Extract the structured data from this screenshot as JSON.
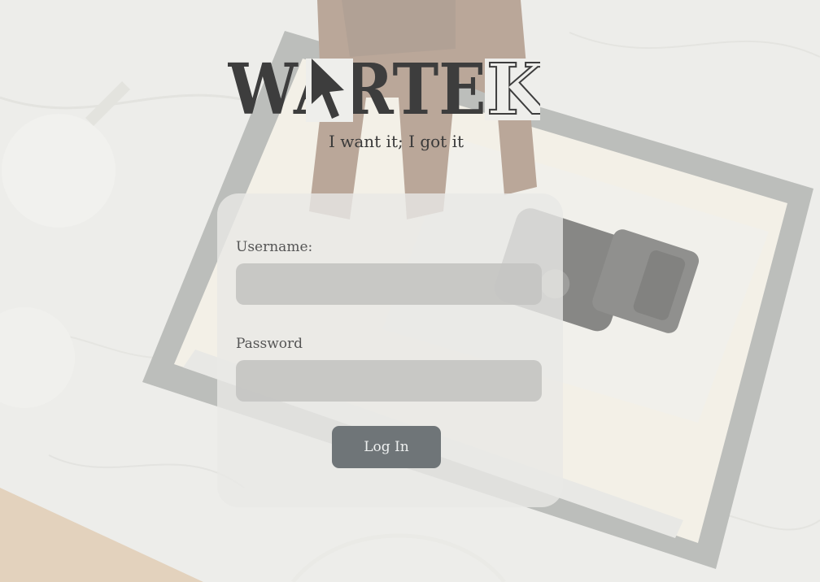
{
  "brand": {
    "logo_text": "WARTEK",
    "tagline": "I want it; I got it"
  },
  "login_form": {
    "username_label": "Username:",
    "username_value": "",
    "password_label": "Password",
    "password_value": "",
    "submit_label": "Log In"
  },
  "colors": {
    "logo_fill": "#3d3d3d",
    "button_bg": "#6f7578",
    "card_bg": "#e8e8e6",
    "input_bg": "#c4c4c2"
  },
  "icons": {
    "cursor": "mouse-pointer-arrow"
  }
}
